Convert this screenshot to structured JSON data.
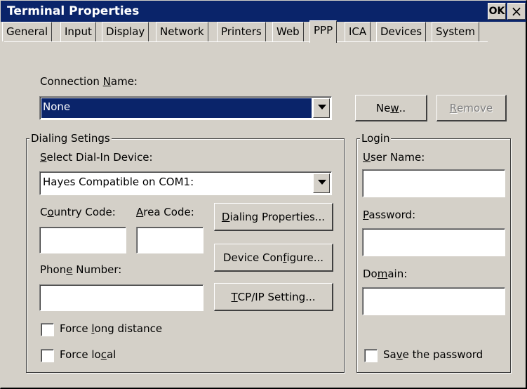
{
  "window": {
    "title": "Terminal Properties",
    "ok_label": "OK",
    "close_label": "×"
  },
  "tabs": [
    {
      "label": "General",
      "active": false
    },
    {
      "label": "Input",
      "active": false
    },
    {
      "label": "Display",
      "active": false
    },
    {
      "label": "Network",
      "active": false
    },
    {
      "label": "Printers",
      "active": false
    },
    {
      "label": "Web",
      "active": false
    },
    {
      "label": "PPP",
      "active": true
    },
    {
      "label": "ICA",
      "active": false
    },
    {
      "label": "Devices",
      "active": false
    },
    {
      "label": "System",
      "active": false
    }
  ],
  "connection": {
    "label_pre": "Connection ",
    "label_u": "N",
    "label_post": "ame:",
    "selected": "None",
    "new_pre": "Ne",
    "new_u": "w",
    "new_post": "..",
    "remove_u": "R",
    "remove_post": "emove"
  },
  "dialing": {
    "legend": "Dialing Setings",
    "device_label_u": "S",
    "device_label_post": "elect Dial-In Device:",
    "device_value": "Hayes Compatible on COM1:",
    "country_pre": "C",
    "country_u": "o",
    "country_post": "untry Code:",
    "area_u": "A",
    "area_post": "rea Code:",
    "country_value": "",
    "area_value": "",
    "dialing_props_u": "D",
    "dialing_props_post": "ialing Properties...",
    "device_config_pre": "Device Con",
    "device_config_u": "f",
    "device_config_post": "igure...",
    "phone_pre": "Phon",
    "phone_u": "e",
    "phone_post": " Number:",
    "phone_value": "",
    "tcpip_u": "T",
    "tcpip_post": "CP/IP Setting...",
    "force_long_pre": "Force ",
    "force_long_u": "l",
    "force_long_post": "ong distance",
    "force_long_checked": false,
    "force_local_pre": "Force lo",
    "force_local_u": "c",
    "force_local_post": "al",
    "force_local_checked": false
  },
  "login": {
    "legend": "Login",
    "user_u": "U",
    "user_post": "ser Name:",
    "user_value": "",
    "password_u": "P",
    "password_post": "assword:",
    "password_value": "",
    "domain_pre": "Do",
    "domain_u": "m",
    "domain_post": "ain:",
    "domain_value": "",
    "save_pre": "Sa",
    "save_u": "v",
    "save_post": "e the password",
    "save_checked": false
  }
}
